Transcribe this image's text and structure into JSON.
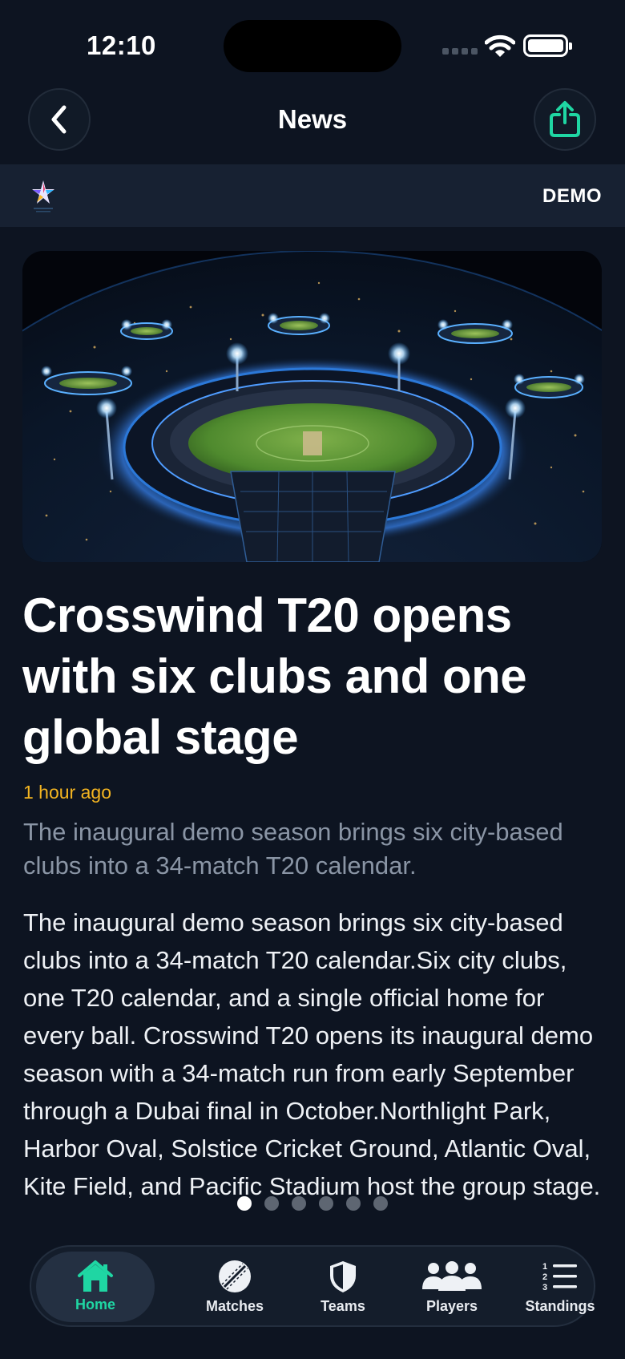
{
  "status_bar": {
    "time": "12:10"
  },
  "header": {
    "title": "News",
    "back_icon": "chevron-left-icon",
    "share_icon": "share-icon"
  },
  "brand": {
    "demo_label": "DEMO"
  },
  "article": {
    "image_alt": "Aerial night view of floodlit cricket stadiums around the globe",
    "headline": "Crosswind T20 opens with six clubs and one global stage",
    "timestamp": "1 hour ago",
    "summary": "The inaugural demo season brings six city-based clubs into a 34-match T20 calendar.",
    "body": "The inaugural demo season brings six city-based clubs into a 34-match T20 calendar.Six city clubs, one T20 calendar, and a single official home for every ball. Crosswind T20 opens its inaugural demo season with a 34-match run from early September through a Dubai final in October.Northlight Park, Harbor Oval, Solstice Cricket Ground, Atlantic Oval, Kite Field, and Pacific Stadium host the group stage."
  },
  "pager": {
    "count": 6,
    "active_index": 0
  },
  "tab_bar": {
    "items": [
      {
        "label": "Home",
        "icon": "home-icon",
        "active": true
      },
      {
        "label": "Matches",
        "icon": "cricket-ball-icon",
        "active": false
      },
      {
        "label": "Teams",
        "icon": "shield-icon",
        "active": false
      },
      {
        "label": "Players",
        "icon": "people-icon",
        "active": false
      },
      {
        "label": "Standings",
        "icon": "numbered-list-icon",
        "active": false
      }
    ]
  },
  "colors": {
    "background": "#0d1421",
    "accent": "#1fd6a3",
    "timestamp": "#f4b521",
    "muted_text": "#8a95a5"
  }
}
